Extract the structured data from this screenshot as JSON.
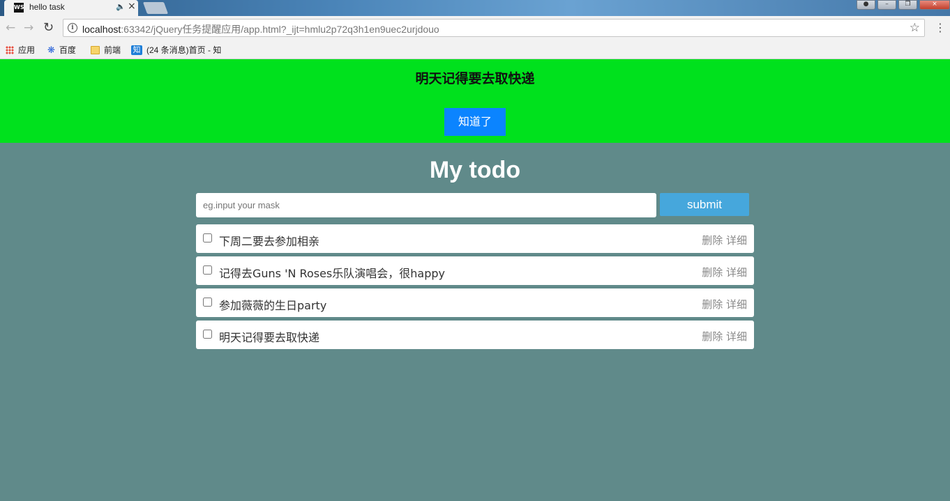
{
  "browser": {
    "tab_title": "hello task",
    "tab_favicon": "WS",
    "url_host": "localhost",
    "url_rest": ":63342/jQuery任务提醒应用/app.html?_ijt=hmlu2p72q3h1en9uec2urjdouo",
    "bookmarks": [
      {
        "icon": "apps-icon",
        "label": "应用"
      },
      {
        "icon": "baidu-icon",
        "label": "百度"
      },
      {
        "icon": "folder-icon",
        "label": "前端"
      },
      {
        "icon": "zhihu-icon",
        "label": "(24 条消息)首页 - 知"
      }
    ]
  },
  "alert": {
    "message": "明天记得要去取快递",
    "button_label": "知道了"
  },
  "app": {
    "title": "My todo",
    "input_placeholder": "eg.input your mask",
    "input_value": "",
    "submit_label": "submit",
    "delete_label": "删除",
    "detail_label": "详细",
    "tasks": [
      {
        "text": "下周二要去参加相亲",
        "done": false
      },
      {
        "text": "记得去Guns 'N Roses乐队演唱会，很happy",
        "done": false
      },
      {
        "text": "参加薇薇的生日party",
        "done": false
      },
      {
        "text": "明天记得要去取快递",
        "done": false
      }
    ]
  },
  "colors": {
    "alert_bg": "#00e11d",
    "alert_button": "#0b84ff",
    "page_bg": "#608a8a",
    "submit_button": "#46a7dc"
  }
}
